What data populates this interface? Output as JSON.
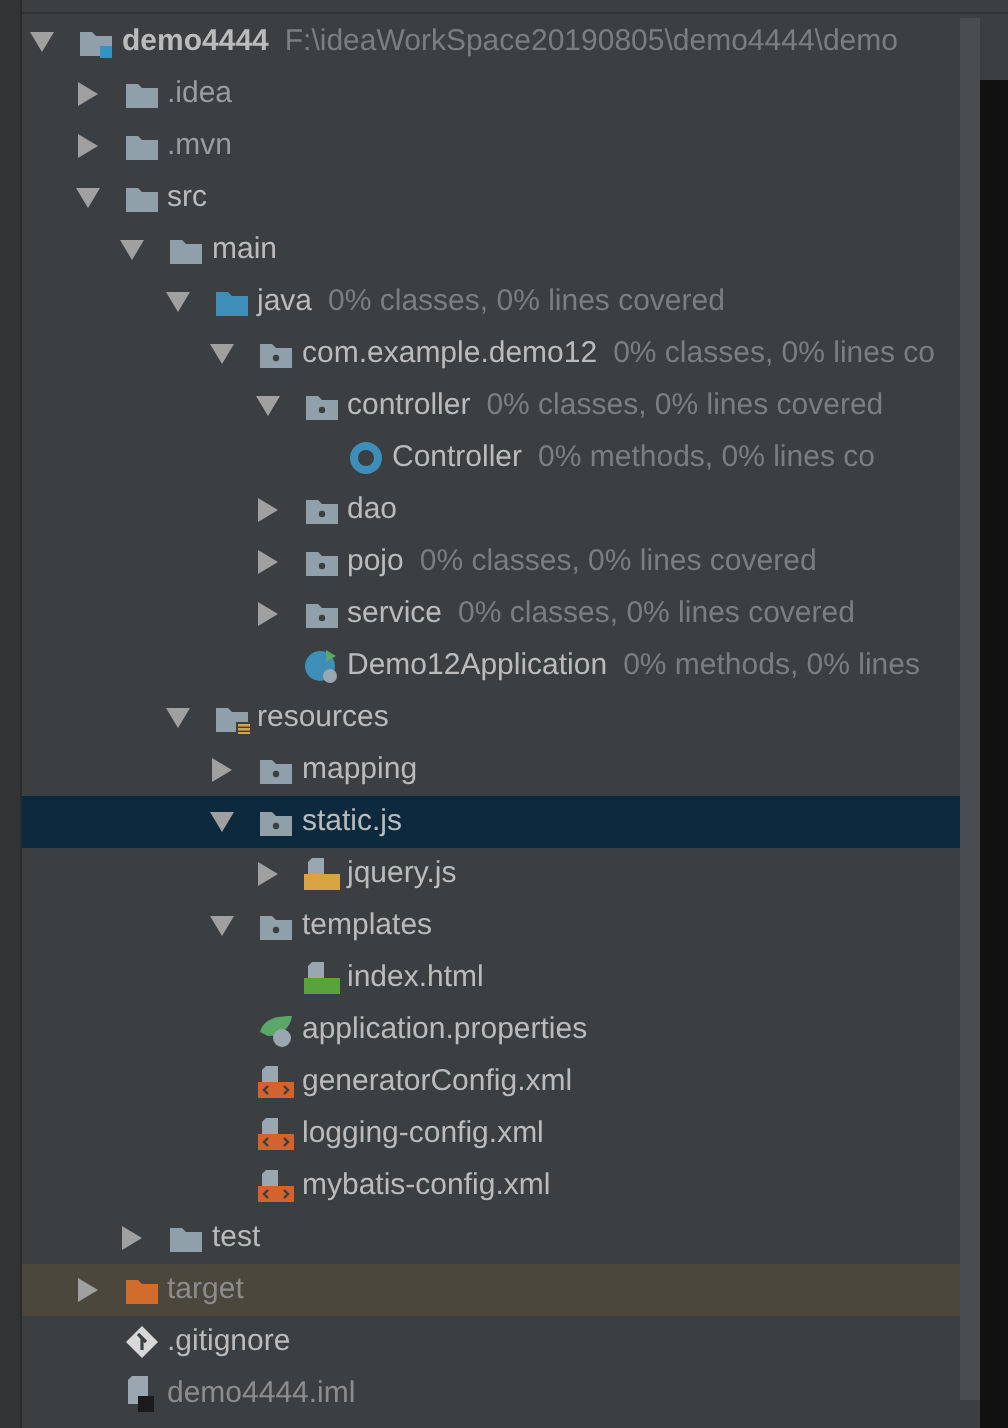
{
  "tree": [
    {
      "name": "demo4444",
      "hint": "F:\\ideaWorkSpace20190805\\demo4444\\demo",
      "kind": "module",
      "expanded": true,
      "selected": false,
      "children": [
        {
          "name": ".idea",
          "kind": "hidden-folder",
          "expanded": false,
          "selected": false
        },
        {
          "name": ".mvn",
          "kind": "hidden-folder",
          "expanded": false,
          "selected": false
        },
        {
          "name": "src",
          "kind": "folder",
          "expanded": true,
          "selected": false,
          "children": [
            {
              "name": "main",
              "kind": "folder",
              "expanded": true,
              "selected": false,
              "children": [
                {
                  "name": "java",
                  "hint": "0% classes, 0% lines covered",
                  "kind": "source-folder",
                  "expanded": true,
                  "selected": false,
                  "children": [
                    {
                      "name": "com.example.demo12",
                      "hint": "0% classes, 0% lines co",
                      "kind": "package",
                      "expanded": true,
                      "selected": false,
                      "children": [
                        {
                          "name": "controller",
                          "hint": "0% classes, 0% lines covered",
                          "kind": "package",
                          "expanded": true,
                          "selected": false,
                          "children": [
                            {
                              "name": "Controller",
                              "hint": "0% methods, 0% lines co",
                              "kind": "class",
                              "selected": false
                            }
                          ]
                        },
                        {
                          "name": "dao",
                          "kind": "package",
                          "expanded": false,
                          "selected": false
                        },
                        {
                          "name": "pojo",
                          "hint": "0% classes, 0% lines covered",
                          "kind": "package",
                          "expanded": false,
                          "selected": false
                        },
                        {
                          "name": "service",
                          "hint": "0% classes, 0% lines covered",
                          "kind": "package",
                          "expanded": false,
                          "selected": false
                        },
                        {
                          "name": "Demo12Application",
                          "hint": "0% methods, 0% lines",
                          "kind": "app-class",
                          "selected": false
                        }
                      ]
                    }
                  ]
                },
                {
                  "name": "resources",
                  "kind": "resources-folder",
                  "expanded": true,
                  "selected": false,
                  "children": [
                    {
                      "name": "mapping",
                      "kind": "package",
                      "expanded": false,
                      "selected": false
                    },
                    {
                      "name": "static.js",
                      "kind": "package",
                      "expanded": true,
                      "selected": true,
                      "children": [
                        {
                          "name": "jquery.js",
                          "kind": "js",
                          "expanded": false,
                          "selected": false
                        }
                      ]
                    },
                    {
                      "name": "templates",
                      "kind": "package",
                      "expanded": true,
                      "selected": false,
                      "children": [
                        {
                          "name": "index.html",
                          "kind": "html",
                          "selected": false
                        }
                      ]
                    },
                    {
                      "name": "application.properties",
                      "kind": "spring-props",
                      "selected": false
                    },
                    {
                      "name": "generatorConfig.xml",
                      "kind": "xml",
                      "selected": false
                    },
                    {
                      "name": "logging-config.xml",
                      "kind": "xml",
                      "selected": false
                    },
                    {
                      "name": "mybatis-config.xml",
                      "kind": "xml",
                      "selected": false
                    }
                  ]
                }
              ]
            },
            {
              "name": "test",
              "kind": "folder",
              "expanded": false,
              "selected": false
            }
          ]
        },
        {
          "name": "target",
          "kind": "excluded-folder",
          "expanded": false,
          "selected": false
        },
        {
          "name": ".gitignore",
          "kind": "git",
          "selected": false
        },
        {
          "name": "demo4444.iml",
          "kind": "iml",
          "selected": false
        }
      ]
    }
  ]
}
